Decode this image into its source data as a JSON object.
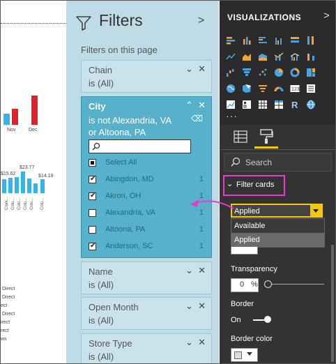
{
  "report": {
    "month_labels": [
      "Nov",
      "Dec"
    ],
    "price_labels": [
      "$15.62",
      "$23.77",
      "$14.18"
    ],
    "category_labels": [
      "Clark...",
      "Colu...",
      "Colo...",
      "Colu...",
      "Colu...",
      "Colu..."
    ],
    "side_texts": [
      "Direct",
      "Direct",
      "ect",
      "Direct",
      "irect",
      "rect",
      "ws"
    ]
  },
  "filters": {
    "title": "Filters",
    "subtitle": "Filters on this page",
    "cards": [
      {
        "name": "Chain",
        "value": "is (All)"
      },
      {
        "name": "Name",
        "value": "is (All)"
      },
      {
        "name": "Open Month",
        "value": "is (All)"
      },
      {
        "name": "Store Type",
        "value": "is (All)"
      }
    ],
    "city": {
      "name": "City",
      "condition": "is not Alexandria, VA or Altoona, PA",
      "search_placeholder": "",
      "options": [
        {
          "label": "Select All",
          "count": "",
          "state": "partial"
        },
        {
          "label": "Abingdon, MD",
          "count": "1",
          "state": "checked"
        },
        {
          "label": "Akron, OH",
          "count": "1",
          "state": "checked"
        },
        {
          "label": "Alexandria, VA",
          "count": "1",
          "state": "unchecked"
        },
        {
          "label": "Altoona, PA",
          "count": "1",
          "state": "unchecked"
        },
        {
          "label": "Anderson, SC",
          "count": "1",
          "state": "checked"
        }
      ]
    }
  },
  "visualizations": {
    "title": "VISUALIZATIONS",
    "search_placeholder": "Search",
    "section": "Filter cards",
    "dropdown_value": "Applied",
    "dropdown_options": [
      "Available",
      "Applied"
    ],
    "transparency_label": "Transparency",
    "transparency_value": "0",
    "transparency_unit": "%",
    "border_label": "Border",
    "border_state": "On",
    "border_color_label": "Border color"
  },
  "colors": {
    "accent_yellow": "#f2c811",
    "highlight_pink": "#e63bd0",
    "city_card": "#57b1cb",
    "filters_bg": "#bfdbe6"
  }
}
